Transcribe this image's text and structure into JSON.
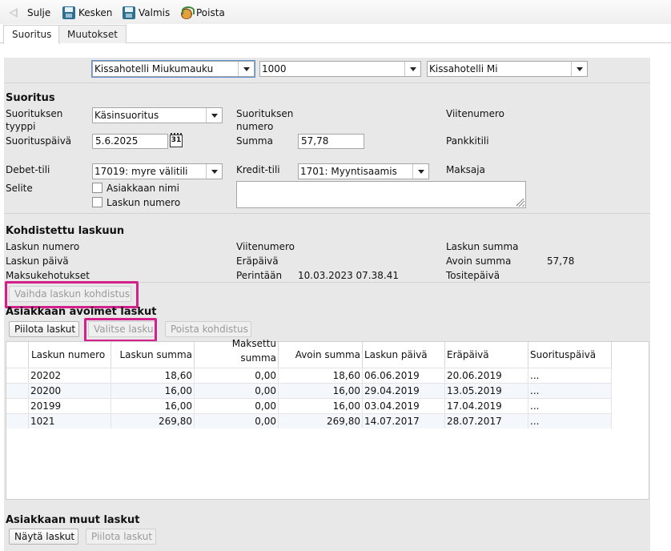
{
  "toolbar": {
    "close_label": "Sulje",
    "pause_label": "Kesken",
    "done_label": "Valmis",
    "delete_label": "Poista"
  },
  "tabs": [
    {
      "label": "Suoritus",
      "active": true
    },
    {
      "label": "Muutokset",
      "active": false
    }
  ],
  "top_selects": {
    "company": "Kissahotelli Miukumauku",
    "code": "1000",
    "company_short": "Kissahotelli Mi"
  },
  "suoritus": {
    "heading": "Suoritus",
    "type_label_line1": "Suorituksen",
    "type_label_line2": "tyyppi",
    "type_value": "Käsinsuoritus",
    "number_label_line1": "Suorituksen",
    "number_label_line2": "numero",
    "reference_label": "Viitenumero",
    "date_label": "Suorituspäivä",
    "date_value": "5.6.2025",
    "calendar_text": "31",
    "amount_label": "Summa",
    "amount_value": "57,78",
    "bank_account_label": "Pankkitili",
    "debit_label": "Debet-tili",
    "debit_value": "17019: myre välitili",
    "credit_label": "Kredit-tili",
    "credit_value": "1701: Myyntisaamis",
    "payer_label": "Maksaja",
    "explanation_label": "Selite",
    "customer_name_label": "Asiakkaan nimi",
    "invoice_number_check_label": "Laskun numero"
  },
  "kohdistettu": {
    "heading": "Kohdistettu laskuun",
    "invoice_number_label": "Laskun numero",
    "reference_label": "Viitenumero",
    "invoice_sum_label": "Laskun summa",
    "invoice_date_label": "Laskun päivä",
    "due_date_label": "Eräpäivä",
    "open_sum_label": "Avoin summa",
    "open_sum_value": "57,78",
    "reminders_label": "Maksukehotukset",
    "collection_label": "Perintään",
    "collection_value": "10.03.2023 07.38.41",
    "voucher_date_label": "Tositepäivä",
    "change_button": "Vaihda laskun kohdistus"
  },
  "open_invoices": {
    "heading": "Asiakkaan avoimet laskut",
    "hide_button": "Piilota laskut",
    "select_button": "Valitse lasku",
    "remove_button": "Poista kohdistus",
    "headers": {
      "number": "Laskun numero",
      "sum": "Laskun summa",
      "paid_line1": "Maksettu",
      "paid_line2": "summa",
      "open": "Avoin summa",
      "date": "Laskun päivä",
      "due": "Eräpäivä",
      "payment_date": "Suorituspäivä"
    },
    "rows": [
      {
        "number": "20202",
        "sum": "18,60",
        "paid": "0,00",
        "open": "18,60",
        "date": "06.06.2019",
        "due": "20.06.2019",
        "payment_date": "..."
      },
      {
        "number": "20200",
        "sum": "16,00",
        "paid": "0,00",
        "open": "16,00",
        "date": "29.04.2019",
        "due": "13.05.2019",
        "payment_date": "..."
      },
      {
        "number": "20199",
        "sum": "16,00",
        "paid": "0,00",
        "open": "16,00",
        "date": "03.04.2019",
        "due": "17.04.2019",
        "payment_date": "..."
      },
      {
        "number": "1021",
        "sum": "269,80",
        "paid": "0,00",
        "open": "269,80",
        "date": "14.07.2017",
        "due": "28.07.2017",
        "payment_date": "..."
      }
    ]
  },
  "other_invoices": {
    "heading": "Asiakkaan muut laskut",
    "show_button": "Näytä laskut",
    "hide_button": "Piilota laskut"
  },
  "colors": {
    "highlight": "#d4208a",
    "panel": "#e8e8e8"
  }
}
